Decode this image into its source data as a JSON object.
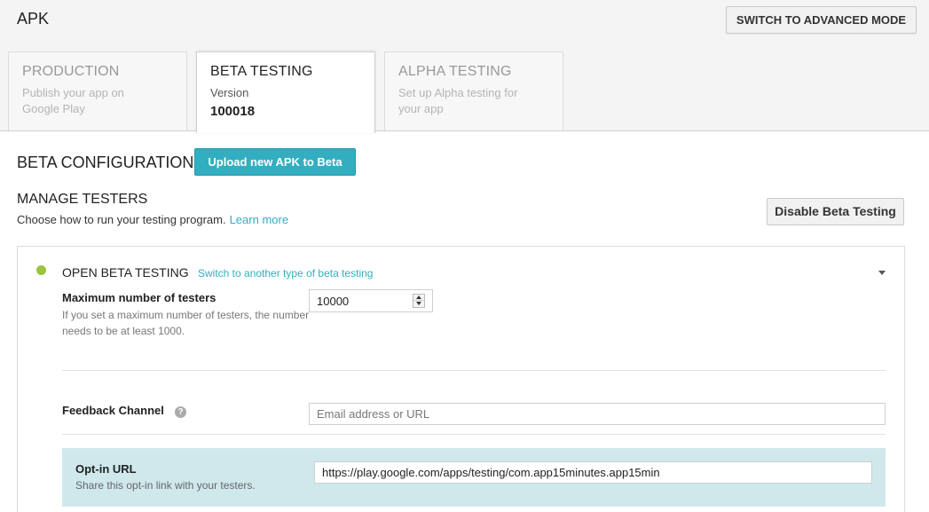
{
  "header": {
    "title": "APK",
    "advanced_mode_label": "SWITCH TO ADVANCED MODE"
  },
  "tabs": [
    {
      "title": "PRODUCTION",
      "subtitle": "Publish your app on Google Play",
      "active": false
    },
    {
      "title": "BETA TESTING",
      "subtitle": "Version",
      "version": "100018",
      "active": true
    },
    {
      "title": "ALPHA TESTING",
      "subtitle": "Set up Alpha testing for your app",
      "active": false
    }
  ],
  "beta": {
    "config_title": "BETA CONFIGURATION",
    "upload_label": "Upload new APK to Beta",
    "manage_title": "MANAGE TESTERS",
    "manage_subtitle": "Choose how to run your testing program.",
    "learn_more": "Learn more",
    "disable_label": "Disable Beta Testing",
    "status_color": "#9bc43e",
    "accent_color": "#33aec1"
  },
  "open_beta": {
    "title": "OPEN BETA TESTING",
    "switch_link": "Switch to another type of beta testing",
    "max_testers_label": "Maximum number of testers",
    "max_testers_help": "If you set a maximum number of testers, the number needs to be at least 1000.",
    "max_testers_value": "10000",
    "feedback_label": "Feedback Channel",
    "feedback_help_icon": "?",
    "feedback_placeholder": "Email address or URL",
    "optin_label": "Opt-in URL",
    "optin_help": "Share this opt-in link with your testers.",
    "optin_value": "https://play.google.com/apps/testing/com.app15minutes.app15min"
  }
}
